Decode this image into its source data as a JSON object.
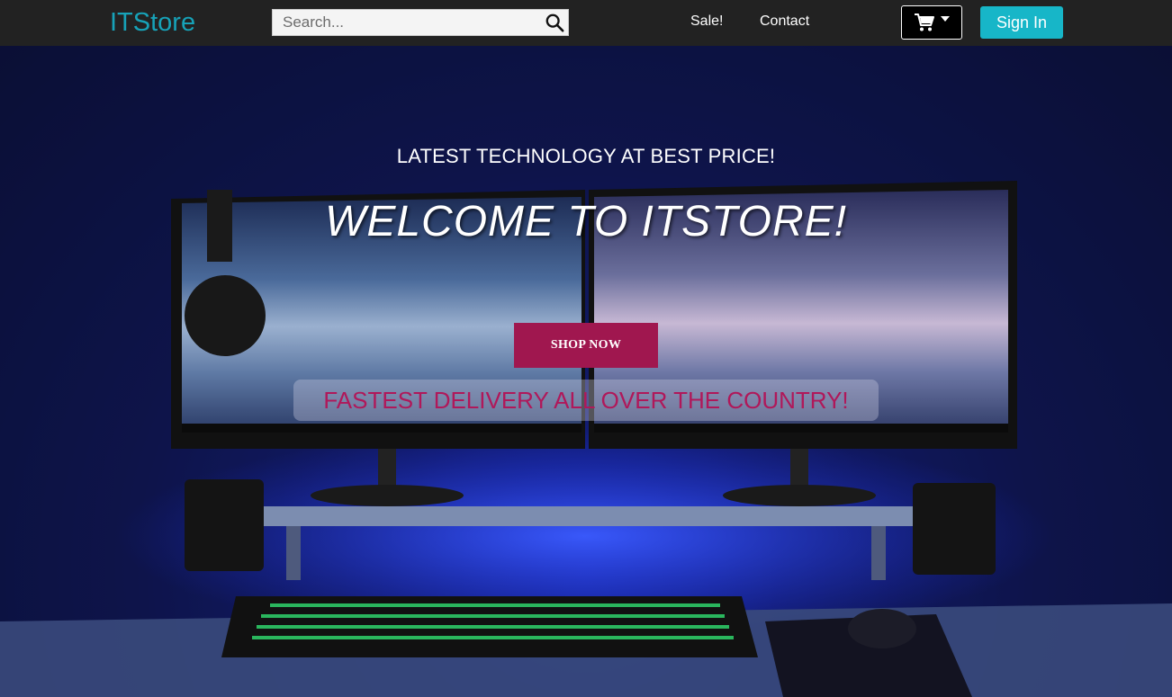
{
  "navbar": {
    "brand": "ITStore",
    "search_placeholder": "Search...",
    "links": [
      "Sale!",
      "Contact"
    ],
    "cart_icon": "shopping-cart-icon",
    "signin_label": "Sign In",
    "colors": {
      "background": "#222222",
      "brand": "#17a2b8",
      "signin": "#17b6c8"
    }
  },
  "hero": {
    "tagline": "LATEST TECHNOLOGY AT BEST PRICE!",
    "title": "WELCOME TO ITSTORE!",
    "shop_button": "SHOP NOW",
    "delivery_text": "FASTEST DELIVERY ALL OVER THE COUNTRY!",
    "colors": {
      "shop_button": "#a0174f",
      "delivery_text": "#b0185a"
    }
  }
}
